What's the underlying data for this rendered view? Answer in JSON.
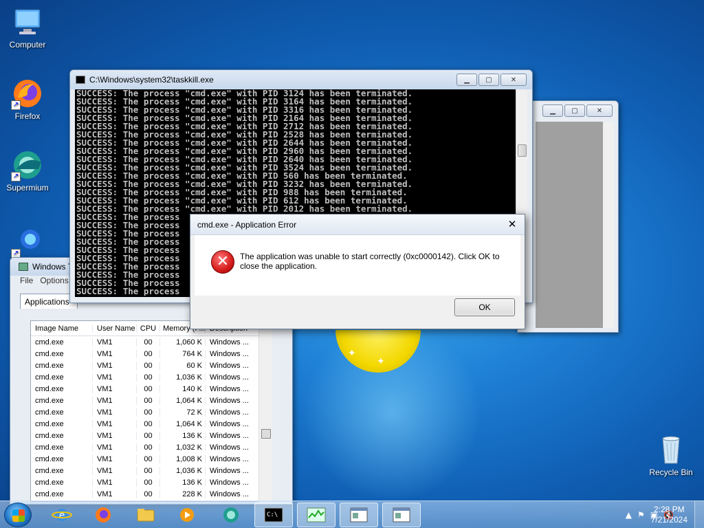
{
  "desktop": {
    "icons": [
      {
        "label": "Computer",
        "icon": "computer-icon"
      },
      {
        "label": "Firefox",
        "icon": "firefox-icon"
      },
      {
        "label": "Supermium",
        "icon": "supermium-icon"
      },
      {
        "label": "Recycle Bin",
        "icon": "recycle-bin-icon"
      }
    ]
  },
  "console": {
    "title": "C:\\Windows\\system32\\taskkill.exe",
    "lines": [
      "SUCCESS: The process \"cmd.exe\" with PID 3124 has been terminated.",
      "SUCCESS: The process \"cmd.exe\" with PID 3164 has been terminated.",
      "SUCCESS: The process \"cmd.exe\" with PID 3316 has been terminated.",
      "SUCCESS: The process \"cmd.exe\" with PID 2164 has been terminated.",
      "SUCCESS: The process \"cmd.exe\" with PID 2712 has been terminated.",
      "SUCCESS: The process \"cmd.exe\" with PID 2528 has been terminated.",
      "SUCCESS: The process \"cmd.exe\" with PID 2644 has been terminated.",
      "SUCCESS: The process \"cmd.exe\" with PID 2960 has been terminated.",
      "SUCCESS: The process \"cmd.exe\" with PID 2640 has been terminated.",
      "SUCCESS: The process \"cmd.exe\" with PID 3524 has been terminated.",
      "SUCCESS: The process \"cmd.exe\" with PID 560 has been terminated.",
      "SUCCESS: The process \"cmd.exe\" with PID 3232 has been terminated.",
      "SUCCESS: The process \"cmd.exe\" with PID 988 has been terminated.",
      "SUCCESS: The process \"cmd.exe\" with PID 612 has been terminated.",
      "SUCCESS: The process \"cmd.exe\" with PID 2012 has been terminated.",
      "SUCCESS: The process",
      "SUCCESS: The process",
      "SUCCESS: The process",
      "SUCCESS: The process",
      "SUCCESS: The process",
      "SUCCESS: The process",
      "SUCCESS: The process",
      "SUCCESS: The process",
      "SUCCESS: The process",
      "SUCCESS: The process"
    ]
  },
  "task_manager": {
    "title": "Windows T",
    "menu": [
      "File",
      "Options"
    ],
    "tab_applications": "Applications",
    "columns": [
      "Image Name",
      "User Name",
      "CPU",
      "Memory (P...",
      "Description"
    ],
    "rows": [
      [
        "cmd.exe",
        "VM1",
        "00",
        "1,060 K",
        "Windows ..."
      ],
      [
        "cmd.exe",
        "VM1",
        "00",
        "764 K",
        "Windows ..."
      ],
      [
        "cmd.exe",
        "VM1",
        "00",
        "60 K",
        "Windows ..."
      ],
      [
        "cmd.exe",
        "VM1",
        "00",
        "1,036 K",
        "Windows ..."
      ],
      [
        "cmd.exe",
        "VM1",
        "00",
        "140 K",
        "Windows ..."
      ],
      [
        "cmd.exe",
        "VM1",
        "00",
        "1,064 K",
        "Windows ..."
      ],
      [
        "cmd.exe",
        "VM1",
        "00",
        "72 K",
        "Windows ..."
      ],
      [
        "cmd.exe",
        "VM1",
        "00",
        "1,064 K",
        "Windows ..."
      ],
      [
        "cmd.exe",
        "VM1",
        "00",
        "136 K",
        "Windows ..."
      ],
      [
        "cmd.exe",
        "VM1",
        "00",
        "1,032 K",
        "Windows ..."
      ],
      [
        "cmd.exe",
        "VM1",
        "00",
        "1,008 K",
        "Windows ..."
      ],
      [
        "cmd.exe",
        "VM1",
        "00",
        "1,036 K",
        "Windows ..."
      ],
      [
        "cmd.exe",
        "VM1",
        "00",
        "136 K",
        "Windows ..."
      ],
      [
        "cmd.exe",
        "VM1",
        "00",
        "228 K",
        "Windows ..."
      ]
    ]
  },
  "dialog": {
    "title": "cmd.exe - Application Error",
    "close_glyph": "✕",
    "message": "The application was unable to start correctly (0xc0000142). Click OK to close the application.",
    "ok_label": "OK"
  },
  "taskbar": {
    "time": "2:28 PM",
    "date": "7/21/2024",
    "apps": [
      "internet-explorer-icon",
      "firefox-icon",
      "explorer-icon",
      "media-player-icon",
      "supermium-icon",
      "cmd-icon",
      "task-manager-icon",
      "window-icon",
      "window-icon"
    ]
  },
  "colors": {
    "console_bg": "#000000",
    "console_text": "#c0c0c0",
    "error_red": "#d51b1b",
    "taskbar": "#7fb0dc"
  }
}
